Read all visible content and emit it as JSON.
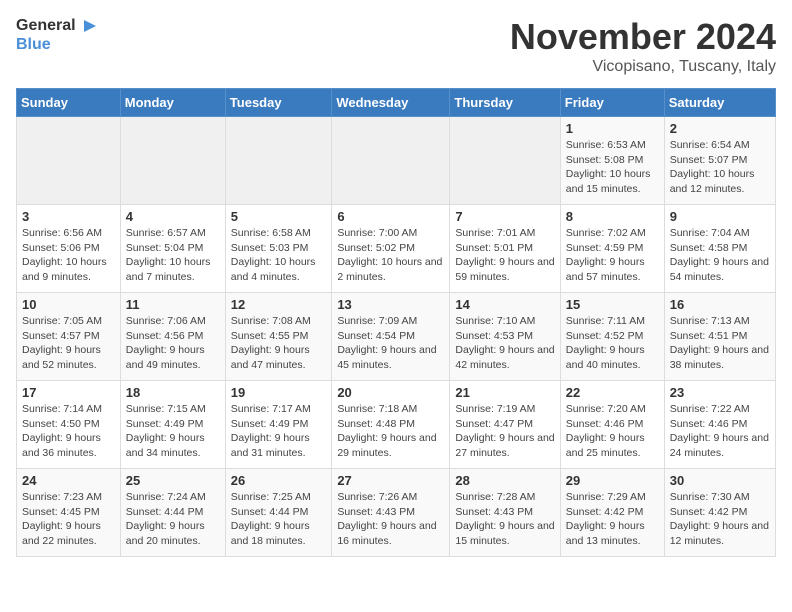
{
  "logo": {
    "line1": "General",
    "line2": "Blue"
  },
  "title": "November 2024",
  "location": "Vicopisano, Tuscany, Italy",
  "weekdays": [
    "Sunday",
    "Monday",
    "Tuesday",
    "Wednesday",
    "Thursday",
    "Friday",
    "Saturday"
  ],
  "weeks": [
    [
      {
        "day": "",
        "info": ""
      },
      {
        "day": "",
        "info": ""
      },
      {
        "day": "",
        "info": ""
      },
      {
        "day": "",
        "info": ""
      },
      {
        "day": "",
        "info": ""
      },
      {
        "day": "1",
        "info": "Sunrise: 6:53 AM\nSunset: 5:08 PM\nDaylight: 10 hours and 15 minutes."
      },
      {
        "day": "2",
        "info": "Sunrise: 6:54 AM\nSunset: 5:07 PM\nDaylight: 10 hours and 12 minutes."
      }
    ],
    [
      {
        "day": "3",
        "info": "Sunrise: 6:56 AM\nSunset: 5:06 PM\nDaylight: 10 hours and 9 minutes."
      },
      {
        "day": "4",
        "info": "Sunrise: 6:57 AM\nSunset: 5:04 PM\nDaylight: 10 hours and 7 minutes."
      },
      {
        "day": "5",
        "info": "Sunrise: 6:58 AM\nSunset: 5:03 PM\nDaylight: 10 hours and 4 minutes."
      },
      {
        "day": "6",
        "info": "Sunrise: 7:00 AM\nSunset: 5:02 PM\nDaylight: 10 hours and 2 minutes."
      },
      {
        "day": "7",
        "info": "Sunrise: 7:01 AM\nSunset: 5:01 PM\nDaylight: 9 hours and 59 minutes."
      },
      {
        "day": "8",
        "info": "Sunrise: 7:02 AM\nSunset: 4:59 PM\nDaylight: 9 hours and 57 minutes."
      },
      {
        "day": "9",
        "info": "Sunrise: 7:04 AM\nSunset: 4:58 PM\nDaylight: 9 hours and 54 minutes."
      }
    ],
    [
      {
        "day": "10",
        "info": "Sunrise: 7:05 AM\nSunset: 4:57 PM\nDaylight: 9 hours and 52 minutes."
      },
      {
        "day": "11",
        "info": "Sunrise: 7:06 AM\nSunset: 4:56 PM\nDaylight: 9 hours and 49 minutes."
      },
      {
        "day": "12",
        "info": "Sunrise: 7:08 AM\nSunset: 4:55 PM\nDaylight: 9 hours and 47 minutes."
      },
      {
        "day": "13",
        "info": "Sunrise: 7:09 AM\nSunset: 4:54 PM\nDaylight: 9 hours and 45 minutes."
      },
      {
        "day": "14",
        "info": "Sunrise: 7:10 AM\nSunset: 4:53 PM\nDaylight: 9 hours and 42 minutes."
      },
      {
        "day": "15",
        "info": "Sunrise: 7:11 AM\nSunset: 4:52 PM\nDaylight: 9 hours and 40 minutes."
      },
      {
        "day": "16",
        "info": "Sunrise: 7:13 AM\nSunset: 4:51 PM\nDaylight: 9 hours and 38 minutes."
      }
    ],
    [
      {
        "day": "17",
        "info": "Sunrise: 7:14 AM\nSunset: 4:50 PM\nDaylight: 9 hours and 36 minutes."
      },
      {
        "day": "18",
        "info": "Sunrise: 7:15 AM\nSunset: 4:49 PM\nDaylight: 9 hours and 34 minutes."
      },
      {
        "day": "19",
        "info": "Sunrise: 7:17 AM\nSunset: 4:49 PM\nDaylight: 9 hours and 31 minutes."
      },
      {
        "day": "20",
        "info": "Sunrise: 7:18 AM\nSunset: 4:48 PM\nDaylight: 9 hours and 29 minutes."
      },
      {
        "day": "21",
        "info": "Sunrise: 7:19 AM\nSunset: 4:47 PM\nDaylight: 9 hours and 27 minutes."
      },
      {
        "day": "22",
        "info": "Sunrise: 7:20 AM\nSunset: 4:46 PM\nDaylight: 9 hours and 25 minutes."
      },
      {
        "day": "23",
        "info": "Sunrise: 7:22 AM\nSunset: 4:46 PM\nDaylight: 9 hours and 24 minutes."
      }
    ],
    [
      {
        "day": "24",
        "info": "Sunrise: 7:23 AM\nSunset: 4:45 PM\nDaylight: 9 hours and 22 minutes."
      },
      {
        "day": "25",
        "info": "Sunrise: 7:24 AM\nSunset: 4:44 PM\nDaylight: 9 hours and 20 minutes."
      },
      {
        "day": "26",
        "info": "Sunrise: 7:25 AM\nSunset: 4:44 PM\nDaylight: 9 hours and 18 minutes."
      },
      {
        "day": "27",
        "info": "Sunrise: 7:26 AM\nSunset: 4:43 PM\nDaylight: 9 hours and 16 minutes."
      },
      {
        "day": "28",
        "info": "Sunrise: 7:28 AM\nSunset: 4:43 PM\nDaylight: 9 hours and 15 minutes."
      },
      {
        "day": "29",
        "info": "Sunrise: 7:29 AM\nSunset: 4:42 PM\nDaylight: 9 hours and 13 minutes."
      },
      {
        "day": "30",
        "info": "Sunrise: 7:30 AM\nSunset: 4:42 PM\nDaylight: 9 hours and 12 minutes."
      }
    ]
  ]
}
